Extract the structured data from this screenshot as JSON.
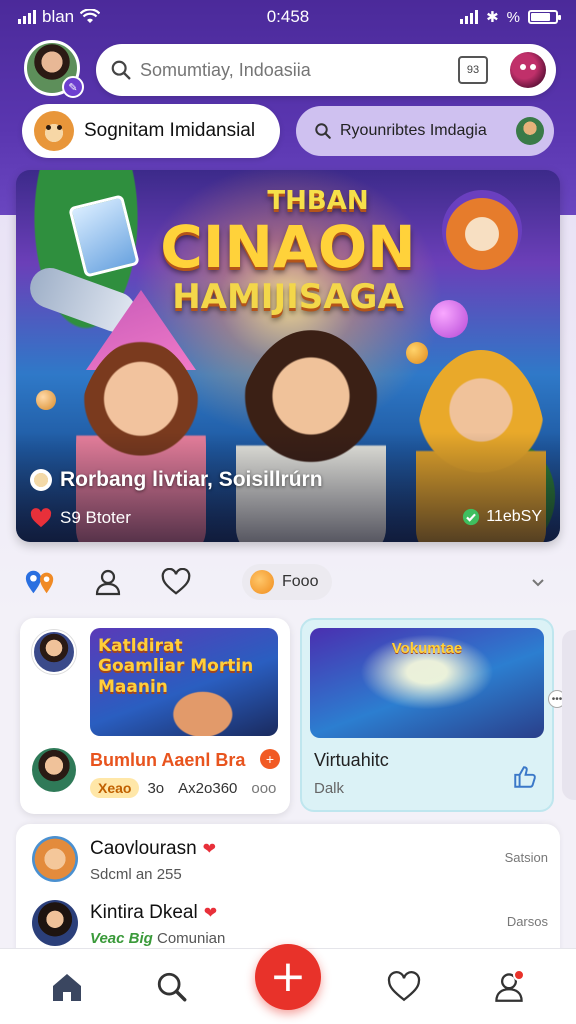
{
  "status_bar": {
    "carrier": "blan",
    "time": "0:458"
  },
  "header": {
    "search_placeholder": "Somumtiay, Indoasiia",
    "scan_label": "93"
  },
  "chips": {
    "left_label": "Sognitam Imidansial",
    "right_label": "Ryounribtes Imdagia"
  },
  "hero": {
    "title_line1": "THBAN",
    "title_line2": "CINAON",
    "title_line3": "HAMIJISAGA",
    "caption": "Rorbang livtiar, Soisillrúrn",
    "likes": "S9 Btoter",
    "tag": "11ebSY"
  },
  "actions": {
    "pill_label": "Fooo"
  },
  "feed_left": {
    "thumb_title": "Katldirat Goamliar Mortin Maanin",
    "name": "Bumlun Aaenl Bra",
    "pill": "Xeao",
    "pill_count": "3o",
    "meta": "Ax2o360",
    "more": "ooo"
  },
  "feed_right": {
    "thumb_title": "Vokumtae",
    "title": "Virtuahitc",
    "subtitle": "Dalk"
  },
  "list": [
    {
      "name": "Caovlourasn",
      "sub": "Sdcml an 255",
      "time": "Satsion"
    },
    {
      "name": "Kintira Dkeal",
      "sub_highlight": "Veac Big",
      "sub": "Comunian",
      "time": "Darsos"
    }
  ],
  "icons": {
    "home": "home-icon",
    "search": "search-icon",
    "add": "plus-icon",
    "favorites": "heart-icon",
    "profile": "user-icon"
  },
  "colors": {
    "brand": "#4b2a9a",
    "accent": "#e8322a",
    "chip_right_bg": "#cfc1f0"
  }
}
